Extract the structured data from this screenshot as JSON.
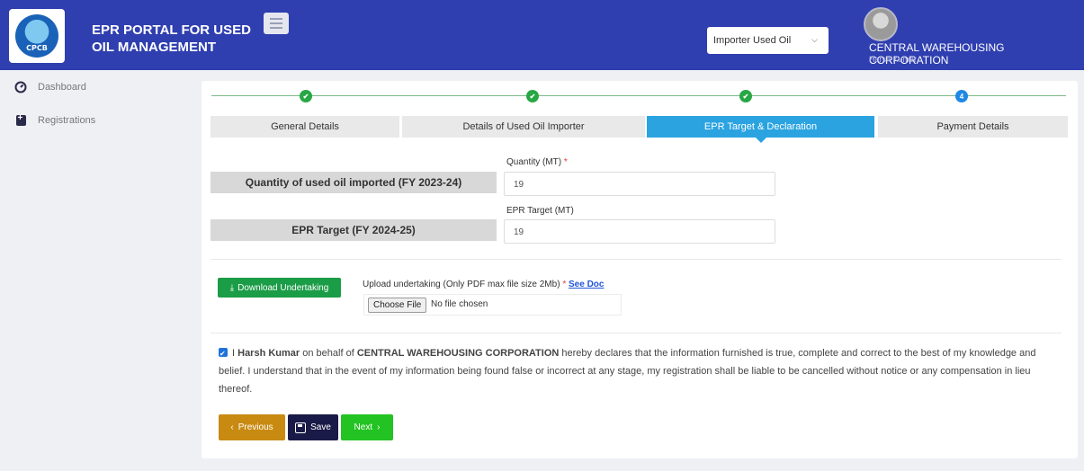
{
  "header": {
    "logo_text": "CPCB",
    "title": "EPR PORTAL FOR USED OIL MANAGEMENT",
    "role_select": {
      "value": "Importer Used Oil"
    },
    "organization": "CENTRAL WAREHOUSING CORPORATION",
    "user_name": "Harsh Kumar"
  },
  "sidebar": {
    "items": [
      {
        "label": "Dashboard",
        "icon": "gauge-icon"
      },
      {
        "label": "Registrations",
        "icon": "add-document-icon"
      }
    ]
  },
  "stepper": {
    "steps": [
      {
        "label": "General Details",
        "status": "done"
      },
      {
        "label": "Details of Used Oil Importer",
        "status": "done"
      },
      {
        "label": "EPR Target & Declaration",
        "status": "done",
        "active": true
      },
      {
        "label": "Payment Details",
        "status": "current",
        "number": "4"
      }
    ]
  },
  "form": {
    "quantity_row_label": "Quantity of used oil imported (FY 2023-24)",
    "quantity_field_label": "Quantity (MT)",
    "quantity_required_mark": "*",
    "quantity_value": "19",
    "target_row_label": "EPR Target (FY 2024-25)",
    "target_field_label": "EPR Target (MT)",
    "target_value": "19"
  },
  "upload": {
    "download_button": "Download Undertaking",
    "label": "Upload undertaking (Only PDF max file size 2Mb)",
    "required_mark": "*",
    "see_doc_link": "See Doc",
    "choose_file_button": "Choose File",
    "no_file_text": "No file chosen"
  },
  "declaration": {
    "checked": true,
    "prefix": "I",
    "name": "Harsh Kumar",
    "middle": "on behalf of",
    "organization": "CENTRAL WAREHOUSING CORPORATION",
    "text": "hereby declares that the information furnished is true, complete and correct to the best of my knowledge and belief. I understand that in the event of my information being found false or incorrect at any stage, my registration shall be liable to be cancelled without notice or any compensation in lieu thereof."
  },
  "actions": {
    "previous": "Previous",
    "save": "Save",
    "next": "Next"
  },
  "colors": {
    "header_bg": "#2f3fb0",
    "active_tab": "#2aa3e0",
    "step_done": "#28a745",
    "step_current": "#1e88e5",
    "download_btn": "#1b9c47",
    "previous_btn": "#c98a12",
    "save_btn": "#1a1a48",
    "next_btn": "#22c322"
  }
}
